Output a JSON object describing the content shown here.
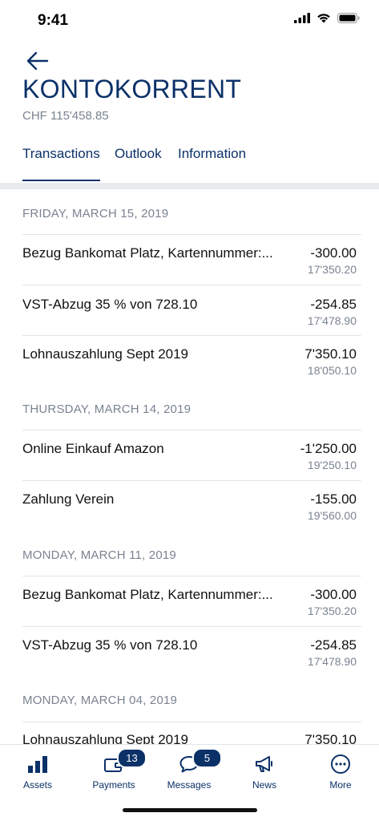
{
  "status": {
    "time": "9:41"
  },
  "header": {
    "title": "KONTOKORRENT",
    "balance": "CHF 115'458.85"
  },
  "tabs": [
    {
      "label": "Transactions",
      "active": true
    },
    {
      "label": "Outlook",
      "active": false
    },
    {
      "label": "Information",
      "active": false
    }
  ],
  "groups": [
    {
      "date": "FRIDAY, MARCH 15, 2019",
      "items": [
        {
          "description": "Bezug Bankomat Platz, Kartennummer:...",
          "amount": "-300.00",
          "balance": "17'350.20"
        },
        {
          "description": "VST-Abzug 35 % von 728.10",
          "amount": "-254.85",
          "balance": "17'478.90"
        },
        {
          "description": "Lohnauszahlung Sept 2019",
          "amount": "7'350.10",
          "balance": "18'050.10"
        }
      ]
    },
    {
      "date": "THURSDAY, MARCH 14, 2019",
      "items": [
        {
          "description": "Online Einkauf Amazon",
          "amount": "-1'250.00",
          "balance": "19'250.10"
        },
        {
          "description": "Zahlung Verein",
          "amount": "-155.00",
          "balance": "19'560.00"
        }
      ]
    },
    {
      "date": "MONDAY, MARCH 11, 2019",
      "items": [
        {
          "description": "Bezug Bankomat Platz, Kartennummer:...",
          "amount": "-300.00",
          "balance": "17'350.20"
        },
        {
          "description": "VST-Abzug 35 % von 728.10",
          "amount": "-254.85",
          "balance": "17'478.90"
        }
      ]
    },
    {
      "date": "MONDAY, MARCH 04, 2019",
      "items": [
        {
          "description": "Lohnauszahlung Sept 2019",
          "amount": "7'350.10",
          "balance": ""
        }
      ]
    }
  ],
  "tabbar": [
    {
      "label": "Assets",
      "icon": "bar-chart-icon",
      "badge": ""
    },
    {
      "label": "Payments",
      "icon": "wallet-icon",
      "badge": "13"
    },
    {
      "label": "Messages",
      "icon": "chat-bubble-icon",
      "badge": "5"
    },
    {
      "label": "News",
      "icon": "megaphone-icon",
      "badge": ""
    },
    {
      "label": "More",
      "icon": "more-icon",
      "badge": ""
    }
  ],
  "colors": {
    "brand": "#0b3168",
    "muted": "#7a8391",
    "divider": "#e3e5e9"
  }
}
